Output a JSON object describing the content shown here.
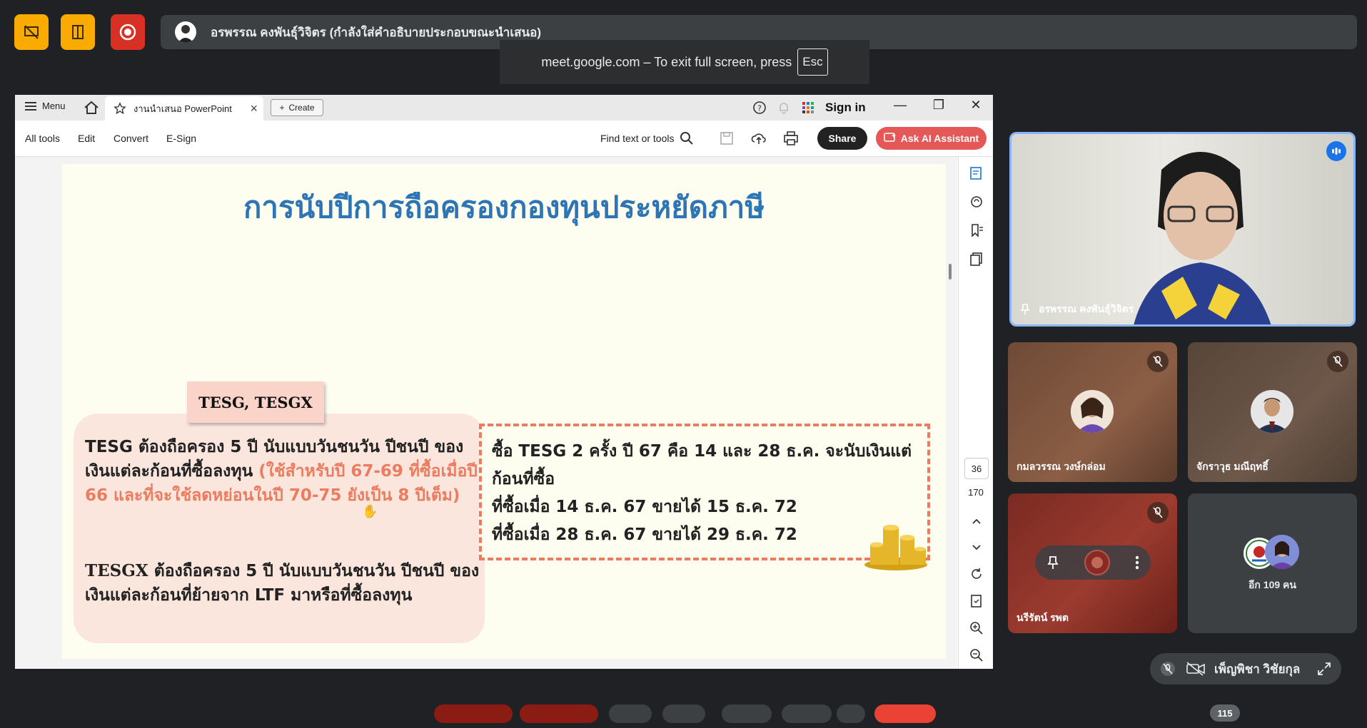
{
  "meet": {
    "presenter_banner": "อรพรรณ คงพันธุ์วิจิตร (กำลังใส่คำอธิบายประกอบขณะนำเสนอ)",
    "fullscreen_toast": "meet.google.com – To exit full screen, press",
    "fullscreen_key": "Esc",
    "participant_count": "115"
  },
  "acrobat": {
    "menu_label": "Menu",
    "tab_title": "งานนำเสนอ PowerPoint",
    "create_label": "Create",
    "signin_label": "Sign in",
    "toolbar": {
      "all_tools": "All tools",
      "edit": "Edit",
      "convert": "Convert",
      "esign": "E-Sign",
      "find": "Find text or tools",
      "share": "Share",
      "ai_assistant": "Ask AI Assistant"
    },
    "page_current": "36",
    "page_total": "170"
  },
  "slide": {
    "title": "การนับปีการถือครองกองทุนประหยัดภาษี",
    "tag": "TESG, TESGX",
    "left_block1_black": "TESG ต้องถือครอง 5 ปี นับแบบวันชนวัน ปีชนปี ของเงินแต่ละก้อนที่ซื้อลงทุน",
    "left_block1_red": "(ใช้สำหรับปี 67-69 ที่ซื้อเมื่อปี 66 และที่จะใช้ลดหย่อนในปี 70-75 ยังเป็น 8 ปีเต็ม)",
    "left_block2_bold": "TESGX",
    "left_block2_rest": "ต้องถือครอง 5 ปี นับแบบวันชนวัน ปีชนปี ของเงินแต่ละก้อนที่ย้ายจาก LTF มาหรือที่ซื้อลงทุน",
    "right_line1": "ซื้อ TESG 2 ครั้ง ปี 67 คือ 14 และ 28 ธ.ค. จะนับเงินแต่ก้อนที่ซื้อ",
    "right_line2": "ที่ซื้อเมื่อ 14 ธ.ค. 67 ขายได้ 15 ธ.ค. 72",
    "right_line3": "ที่ซื้อเมื่อ 28 ธ.ค. 67 ขายได้ 29 ธ.ค. 72"
  },
  "participants": {
    "main": "อรพรรณ คงพันธุ์วิจิตร",
    "p1": "กมลวรรณ วงษ์กล่อม",
    "p2": "จักราวุธ มณีฤทธิ์",
    "p3": "นรีรัตน์ รพต",
    "others": "อีก 109 คน",
    "self": "เพ็ญพิชา วิชัยกุล"
  },
  "colors": {
    "yellow": "#f9ab00",
    "red": "#d93025",
    "slide_title_blue": "#2e75b6",
    "accent_orange": "#ec7c5f",
    "speaking_blue": "#1a73e8"
  }
}
